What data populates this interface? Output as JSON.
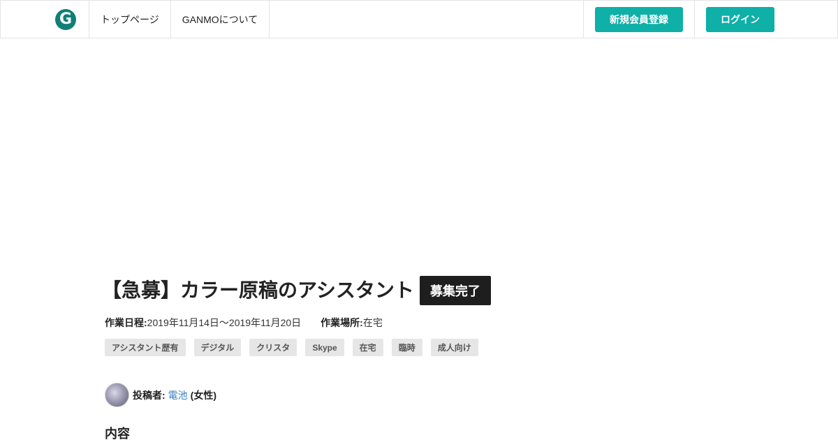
{
  "header": {
    "logo_letter": "G",
    "nav": [
      "トップページ",
      "GANMOについて"
    ],
    "register_label": "新規会員登録",
    "login_label": "ログイン"
  },
  "job": {
    "title": "【急募】カラー原稿のアシスタント",
    "status": "募集完了",
    "schedule_label": "作業日程:",
    "schedule_value": "2019年11月14日〜2019年11月20日",
    "location_label": "作業場所:",
    "location_value": "在宅",
    "tags": [
      "アシスタント歴有",
      "デジタル",
      "クリスタ",
      "Skype",
      "在宅",
      "臨時",
      "成人向け"
    ]
  },
  "poster": {
    "label": "投稿者:",
    "name": "電池",
    "gender": "(女性)"
  },
  "section": {
    "heading": "内容"
  },
  "colors": {
    "accent": "#0eb0a8",
    "logo": "#0f7f78",
    "badge": "#1e1e1e",
    "link": "#3a7fc1"
  }
}
